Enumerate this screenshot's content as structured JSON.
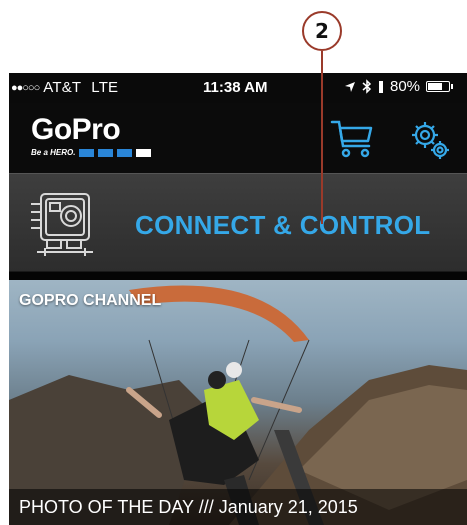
{
  "callout": {
    "number": "2"
  },
  "status_bar": {
    "signal_dots": "●●○○○",
    "carrier": "AT&T",
    "network": "LTE",
    "time": "11:38 AM",
    "battery_text": "80%",
    "battery_level": 0.8
  },
  "header": {
    "logo_text": "GoPro",
    "logo_tagline": "Be a HERO.",
    "cart_icon": "cart-icon",
    "settings_icon": "gear-icon"
  },
  "connect": {
    "label": "CONNECT & CONTROL",
    "icon": "camera-icon",
    "color": "#35a8e8"
  },
  "channel": {
    "title": "GOPRO CHANNEL",
    "caption": "PHOTO OF THE DAY /// January 21, 2015"
  }
}
